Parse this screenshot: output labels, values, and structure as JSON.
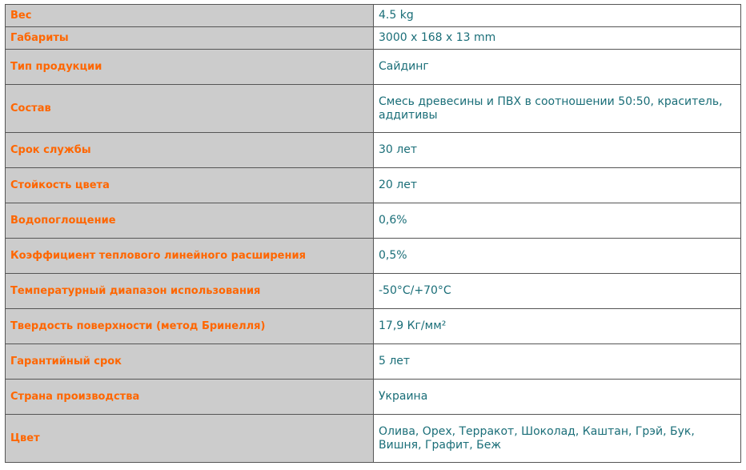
{
  "colors": {
    "label_text": "#ff6600",
    "label_bg": "#cccccc",
    "value_text": "#1a6e78",
    "border": "#555555"
  },
  "rows": [
    {
      "label": "Вес",
      "value": "4.5 kg"
    },
    {
      "label": "Габариты",
      "value": "3000 x 168 x 13 mm"
    },
    {
      "label": "Тип продукции",
      "value": "Сайдинг"
    },
    {
      "label": "Состав",
      "value": "Смесь древесины и ПВХ в соотношении 50:50, краситель, аддитивы"
    },
    {
      "label": "Срок службы",
      "value": "30 лет"
    },
    {
      "label": "Стойкость цвета",
      "value": "20 лет"
    },
    {
      "label": "Водопоглощение",
      "value": "0,6%"
    },
    {
      "label": "Коэффициент теплового линейного расширения",
      "value": "0,5%"
    },
    {
      "label": "Температурный диапазон использования",
      "value": "-50°С/+70°С"
    },
    {
      "label": "Твердость поверхности (метод Бринелля)",
      "value": "17,9 Кг/мм²"
    },
    {
      "label": "Гарантийный срок",
      "value": "5 лет"
    },
    {
      "label": "Страна производства",
      "value": "Украина"
    },
    {
      "label": "Цвет",
      "value": "Олива, Орех, Терракот, Шоколад, Каштан, Грэй, Бук, Вишня, Графит, Беж"
    }
  ]
}
